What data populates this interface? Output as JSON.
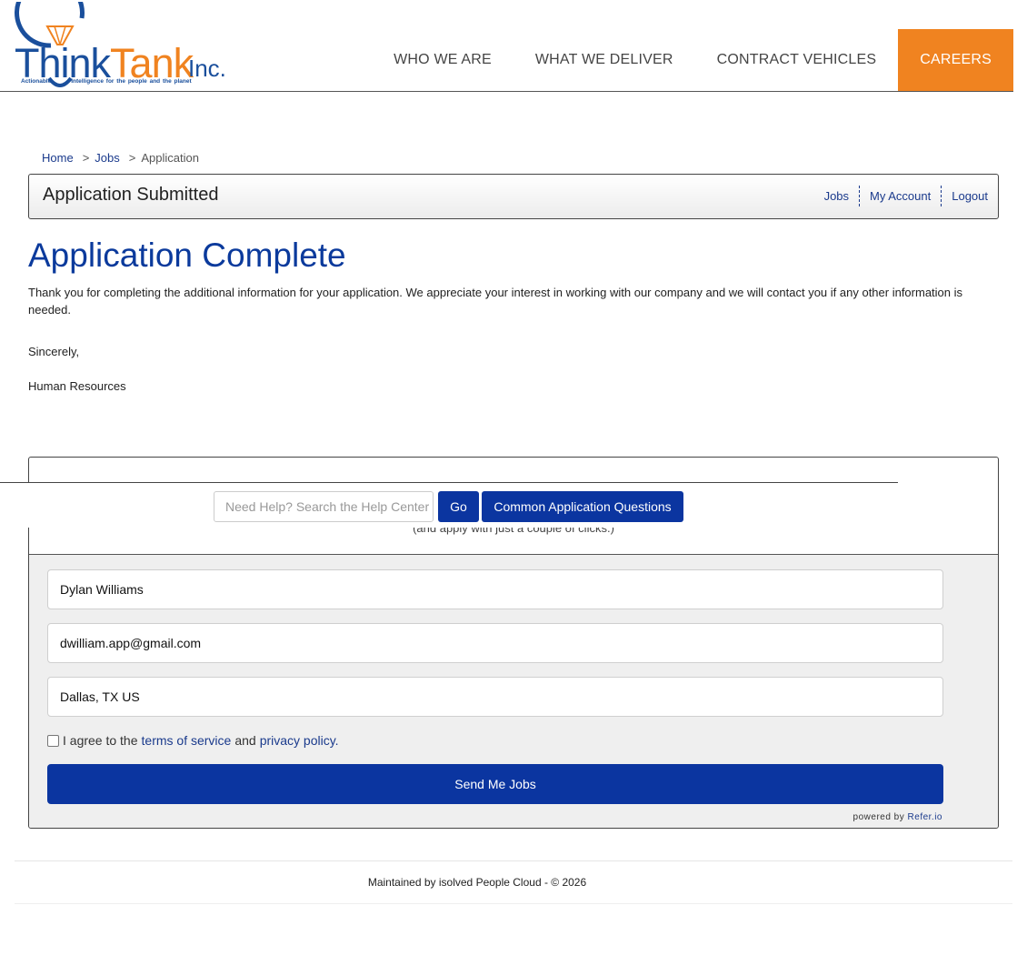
{
  "brand": {
    "word_think": "Think",
    "word_tank": "Tank",
    "inc": "Inc.",
    "tagline_a": "Actionable",
    "tagline_b": "Intelligence for the people and the planet",
    "colors": {
      "blue": "#1a4f9c",
      "orange": "#f08320"
    }
  },
  "nav": {
    "items": [
      {
        "label": "WHO WE ARE"
      },
      {
        "label": "WHAT WE DELIVER"
      },
      {
        "label": "CONTRACT VEHICLES"
      },
      {
        "label": "CAREERS",
        "active": true
      }
    ]
  },
  "breadcrumb": {
    "home": "Home",
    "jobs": "Jobs",
    "current": "Application",
    "sep": ">"
  },
  "submitted": {
    "title": "Application Submitted",
    "links": {
      "jobs": "Jobs",
      "account": "My Account",
      "logout": "Logout"
    }
  },
  "content": {
    "heading": "Application Complete",
    "message": "Thank you for completing the additional information for your application. We appreciate your interest in working with our company and we will contact you if any other information is needed.",
    "sincerely": "Sincerely,",
    "signature": "Human Resources"
  },
  "help": {
    "placeholder": "Need Help? Search the Help Center",
    "go": "Go",
    "common": "Common Application Questions"
  },
  "widget": {
    "subtitle": "(and apply with just a couple of clicks.)",
    "name_value": "Dylan Williams",
    "email_value": "dwilliam.app@gmail.com",
    "location_value": "Dallas, TX US",
    "agree_prefix": "I agree to the",
    "terms": "terms of service",
    "and": "and",
    "privacy": "privacy policy.",
    "send": "Send Me Jobs",
    "powered_by": "powered by",
    "refer": "Refer.io",
    "accent": "#0b35a0"
  },
  "footer": {
    "text": "Maintained by isolved People Cloud - © 2026"
  }
}
